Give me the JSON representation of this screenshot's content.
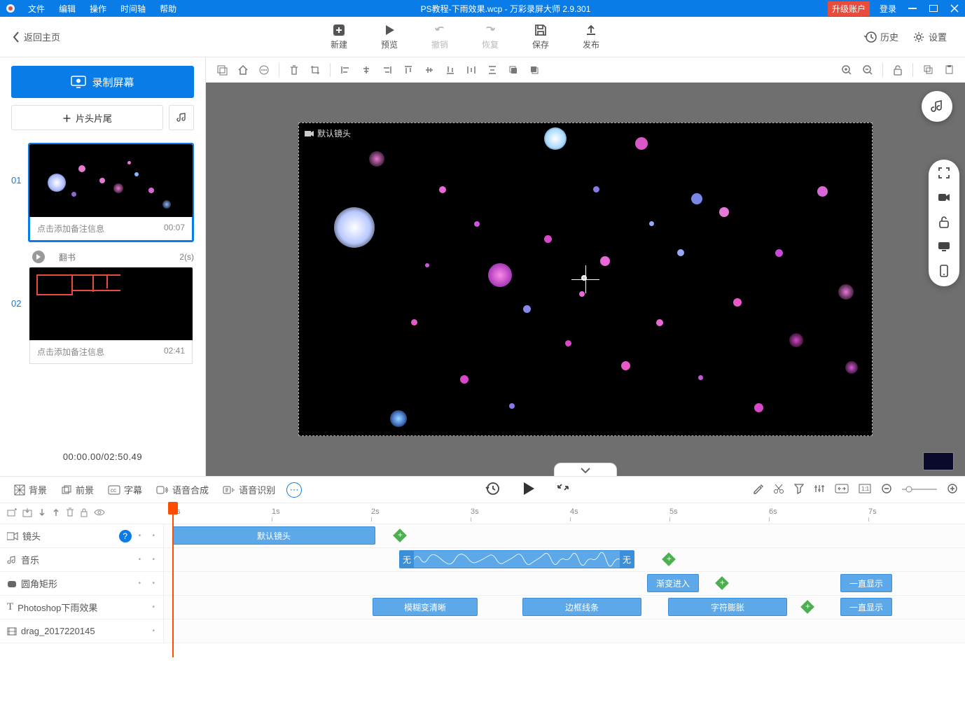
{
  "titlebar": {
    "menus": [
      "文件",
      "编辑",
      "操作",
      "时间轴",
      "帮助"
    ],
    "title": "PS教程-下雨效果.wcp - 万彩录屏大师 2.9.301",
    "upgrade": "升级账户",
    "login": "登录"
  },
  "toolbar": {
    "back": "返回主页",
    "items": [
      {
        "id": "new",
        "label": "新建"
      },
      {
        "id": "preview",
        "label": "预览"
      },
      {
        "id": "undo",
        "label": "撤销",
        "disabled": true
      },
      {
        "id": "redo",
        "label": "恢复",
        "disabled": true
      },
      {
        "id": "save",
        "label": "保存"
      },
      {
        "id": "publish",
        "label": "发布"
      }
    ],
    "history": "历史",
    "settings": "设置"
  },
  "left": {
    "record": "录制屏幕",
    "intro": "片头片尾",
    "scenes": [
      {
        "num": "01",
        "note": "点击添加备注信息",
        "time": "00:07",
        "active": true
      },
      {
        "num": "02",
        "note": "点击添加备注信息",
        "time": "02:41",
        "active": false
      }
    ],
    "transition": {
      "name": "翻书",
      "duration": "2(s)"
    },
    "timeinfo": "00:00.00/02:50.49"
  },
  "canvas": {
    "cam_label": "默认镜头"
  },
  "tabs": {
    "items": [
      {
        "id": "bg",
        "label": "背景"
      },
      {
        "id": "fg",
        "label": "前景"
      },
      {
        "id": "cc",
        "label": "字幕"
      },
      {
        "id": "tts",
        "label": "语音合成"
      },
      {
        "id": "asr",
        "label": "语音识别"
      }
    ]
  },
  "ruler": {
    "ticks": [
      "0s",
      "1s",
      "2s",
      "3s",
      "4s",
      "5s",
      "6s",
      "7s"
    ]
  },
  "tracks": [
    {
      "id": "camera",
      "label": "镜头",
      "help": true
    },
    {
      "id": "music",
      "label": "音乐"
    },
    {
      "id": "rect",
      "label": "圆角矩形"
    },
    {
      "id": "text",
      "label": "Photoshop下雨效果"
    },
    {
      "id": "drag",
      "label": "drag_2017220145"
    }
  ],
  "clips": {
    "camera_default": "默认镜头",
    "music_none": "无",
    "rect_in": "渐变进入",
    "rect_show": "一直显示",
    "text_a": "模糊变清晰",
    "text_b": "边框线条",
    "text_c": "字符膨胀",
    "text_show": "一直显示"
  }
}
